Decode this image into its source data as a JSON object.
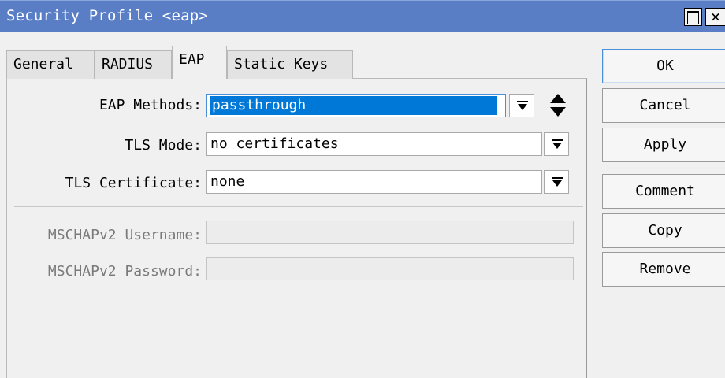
{
  "window": {
    "title": "Security Profile <eap>"
  },
  "tabs": [
    {
      "label": "General"
    },
    {
      "label": "RADIUS"
    },
    {
      "label": "EAP"
    },
    {
      "label": "Static Keys"
    }
  ],
  "active_tab": "EAP",
  "form": {
    "eap_methods": {
      "label": "EAP Methods:",
      "value": "passthrough"
    },
    "tls_mode": {
      "label": "TLS Mode:",
      "value": "no certificates"
    },
    "tls_certificate": {
      "label": "TLS Certificate:",
      "value": "none"
    },
    "mschap_username": {
      "label": "MSCHAPv2 Username:",
      "value": ""
    },
    "mschap_password": {
      "label": "MSCHAPv2 Password:",
      "value": ""
    }
  },
  "buttons": {
    "ok": "OK",
    "cancel": "Cancel",
    "apply": "Apply",
    "comment": "Comment",
    "copy": "Copy",
    "remove": "Remove"
  },
  "colors": {
    "titlebar": "#5a7ec6",
    "selection": "#0078d7"
  }
}
